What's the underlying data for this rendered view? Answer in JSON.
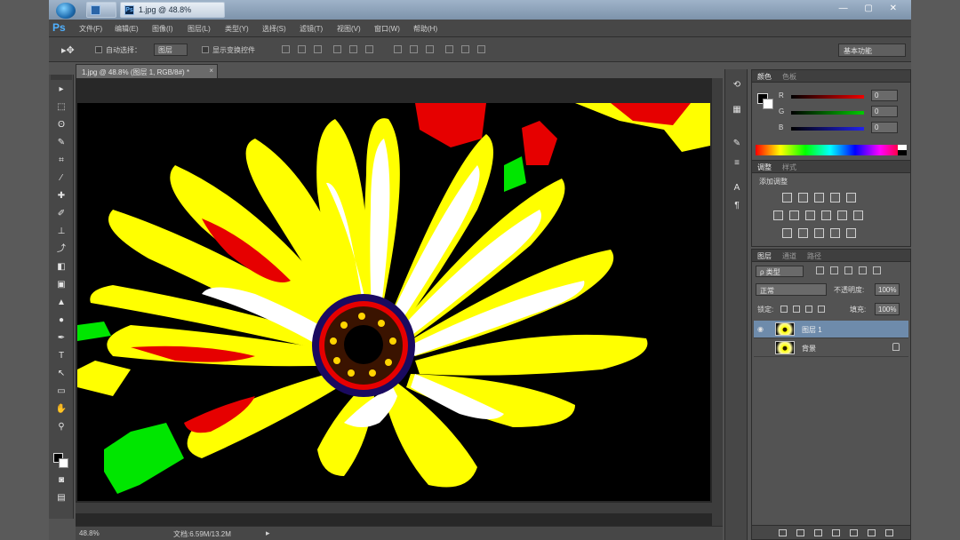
{
  "os": {
    "taskbar": [
      {
        "label": "",
        "icon": "window-icon"
      },
      {
        "label": "1.jpg @ 48.8%",
        "icon": "photoshop-icon"
      }
    ]
  },
  "app": {
    "logo": "Ps",
    "menu": [
      "文件(F)",
      "编辑(E)",
      "图像(I)",
      "图层(L)",
      "类型(Y)",
      "选择(S)",
      "滤镜(T)",
      "视图(V)",
      "窗口(W)",
      "帮助(H)"
    ]
  },
  "options": {
    "auto_select_label": "自动选择：",
    "auto_select_target": "图层",
    "show_transform_label": "显示变换控件",
    "workspace": "基本功能"
  },
  "document": {
    "tab_title": "1.jpg @ 48.8% (图层 1, RGB/8#) *",
    "close": "×"
  },
  "status": {
    "zoom": "48.8%",
    "doc_size": "文档:6.59M/13.2M",
    "arrow": "▸"
  },
  "panels": {
    "color": {
      "tabs": [
        "颜色",
        "色板"
      ],
      "channels": [
        {
          "label": "R",
          "value": "0",
          "color": "#d21a1a"
        },
        {
          "label": "G",
          "value": "0",
          "color": "#1fa51f"
        },
        {
          "label": "B",
          "value": "0",
          "color": "#1a3fd2"
        }
      ]
    },
    "adjust": {
      "tabs": [
        "调整",
        "样式"
      ],
      "title": "添加调整"
    },
    "layers": {
      "tabs": [
        "图层",
        "通道",
        "路径"
      ],
      "kind": "ρ 类型",
      "blend_mode": "正常",
      "opacity_label": "不透明度:",
      "opacity": "100%",
      "lock_label": "锁定:",
      "fill_label": "填充:",
      "fill": "100%",
      "items": [
        {
          "name": "图层 1",
          "selected": true,
          "visible": true,
          "locked": false
        },
        {
          "name": "背景",
          "selected": false,
          "visible": false,
          "locked": true
        }
      ]
    }
  },
  "colors": {
    "accent": "#4fb0ff",
    "selected_layer": "#6e8bab",
    "petal_yellow": "#ffff00",
    "petal_white": "#ffffff",
    "red": "#e60000",
    "green": "#00e600"
  }
}
